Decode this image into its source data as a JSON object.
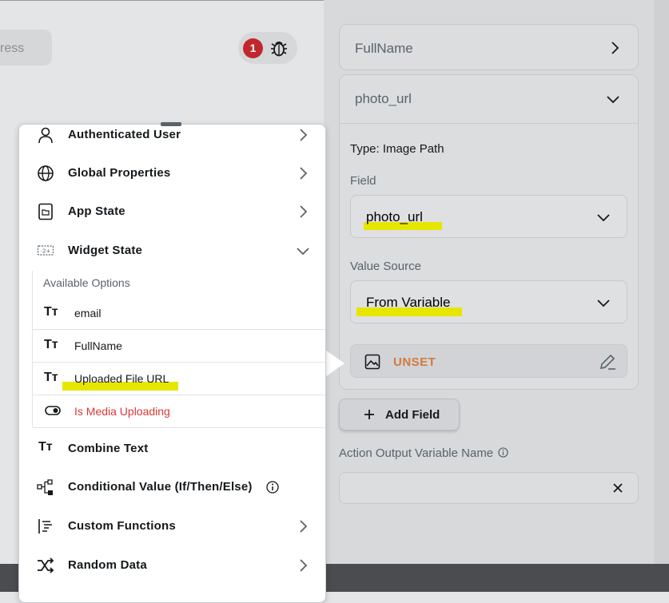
{
  "background": {
    "address_text": "ress",
    "bug_badge_count": "1"
  },
  "right_panel": {
    "rows": [
      {
        "label": "FullName",
        "icon": "chevron-right-icon"
      },
      {
        "label": "photo_url",
        "icon": "chevron-down-icon"
      }
    ],
    "type_label": "Type: Image Path",
    "field_label": "Field",
    "field_value": "photo_url",
    "value_source_label": "Value Source",
    "value_source_value": "From Variable",
    "unset_label": "UNSET",
    "add_field_label": "Add Field",
    "output_variable_label": "Action Output Variable Name"
  },
  "popup": {
    "items": [
      {
        "label": "Authenticated User",
        "icon": "person-icon",
        "trailing": "chevron-right-icon"
      },
      {
        "label": "Global Properties",
        "icon": "globe-icon",
        "trailing": "chevron-right-icon"
      },
      {
        "label": "App State",
        "icon": "app-state-icon",
        "trailing": "chevron-right-icon"
      },
      {
        "label": "Widget State",
        "icon": "widget-state-icon",
        "trailing": "chevron-down-icon"
      }
    ],
    "available_options_title": "Available Options",
    "options": [
      {
        "label": "email",
        "icon": "text-icon"
      },
      {
        "label": "FullName",
        "icon": "text-icon"
      },
      {
        "label": "Uploaded File URL",
        "icon": "text-icon"
      },
      {
        "label": "Is Media Uploading",
        "icon": "toggle-icon"
      }
    ],
    "tt_glyph": "Tт",
    "more_items": [
      {
        "label": "Combine Text",
        "icon": "text-icon"
      },
      {
        "label": "Conditional Value (If/Then/Else)",
        "icon": "conditional-icon",
        "trailing": "info-icon"
      },
      {
        "label": "Custom Functions",
        "icon": "functions-icon",
        "trailing": "chevron-right-icon"
      },
      {
        "label": "Random Data",
        "icon": "shuffle-icon",
        "trailing": "chevron-right-icon"
      }
    ]
  },
  "colors": {
    "highlight": "#e6e600",
    "unset": "#d2793e",
    "error_red": "#d93737",
    "badge_red": "#c1282d"
  }
}
